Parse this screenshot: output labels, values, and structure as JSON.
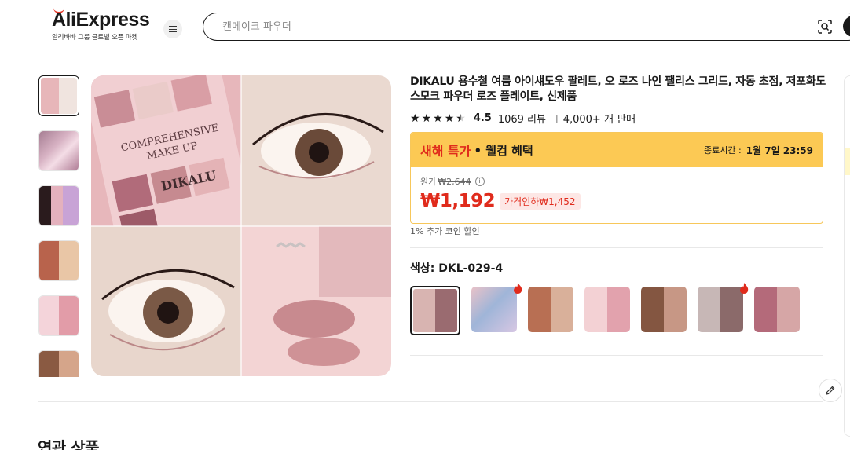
{
  "header": {
    "logo_text": "AliExpress",
    "logo_tagline": "알리바바 그룹 글로벌 오픈 마켓",
    "search_placeholder": "캔메이크 파우더"
  },
  "product": {
    "title": "DIKALU 용수철 여름 아이섀도우 팔레트, 오 로즈 나인 팰리스 그리드, 자동 초점, 저포화도 스모크 파우더 로즈 플레이트, 신제품",
    "rating": "4.5",
    "reviews": "1069 리뷰",
    "sold": "4,000+ 개 판매",
    "promo": {
      "title": "새해 특가",
      "subtitle": "• 웰컴 혜택",
      "end_label": "종료시간 :",
      "end_time": "1월 7일 23:59"
    },
    "original_label": "원가",
    "original_price": "₩2,644",
    "price": "₩1,192",
    "discount": "가격인하₩1,452",
    "coin_note": "1% 추가 코인 할인",
    "color_label": "색상: DKL-029-4"
  },
  "gallery": {
    "thumbnail_count": 6,
    "main_image_alt": "eyeshadow palette and eye makeup"
  },
  "related_title": "연관 상품",
  "colors": {
    "brand_red": "#e02b1c",
    "promo_yellow": "#fcc954"
  }
}
